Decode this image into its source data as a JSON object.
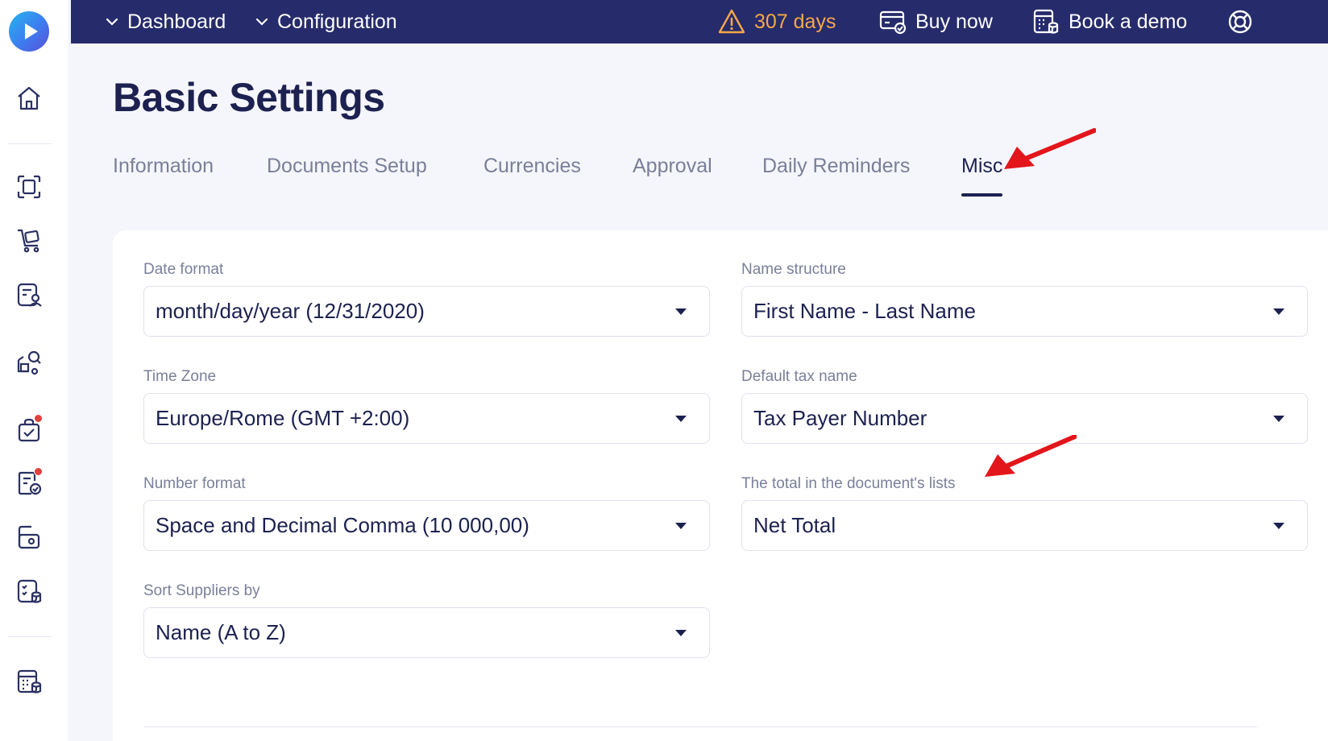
{
  "topbar": {
    "menu1": "Dashboard",
    "menu2": "Configuration",
    "trial": "307 days",
    "buy": "Buy now",
    "demo": "Book a demo"
  },
  "page": {
    "title": "Basic Settings"
  },
  "tabs": [
    "Information",
    "Documents Setup",
    "Currencies",
    "Approval",
    "Daily Reminders",
    "Misc"
  ],
  "active_tab": "Misc",
  "fields": {
    "date_format": {
      "label": "Date format",
      "value": "month/day/year (12/31/2020)"
    },
    "time_zone": {
      "label": "Time Zone",
      "value": "Europe/Rome (GMT +2:00)"
    },
    "number_format": {
      "label": "Number format",
      "value": "Space and Decimal Comma (10 000,00)"
    },
    "sort_suppliers": {
      "label": "Sort Suppliers by",
      "value": "Name (A to Z)"
    },
    "name_structure": {
      "label": "Name structure",
      "value": "First Name - Last Name"
    },
    "default_tax": {
      "label": "Default tax name",
      "value": "Tax Payer Number"
    },
    "document_total": {
      "label": "The total in the document's lists",
      "value": "Net Total"
    }
  },
  "colors": {
    "topbar": "#262b6b",
    "accent": "#1c2150",
    "warning": "#f5a74b",
    "annotation_arrow": "#e3161b"
  },
  "icons": [
    "home-icon",
    "scan-icon",
    "cart-icon",
    "invoice-user-icon",
    "supplier-search-icon",
    "approval-bag-icon",
    "document-check-icon",
    "wallet-icon",
    "list-db-icon",
    "calculator-db-icon"
  ]
}
